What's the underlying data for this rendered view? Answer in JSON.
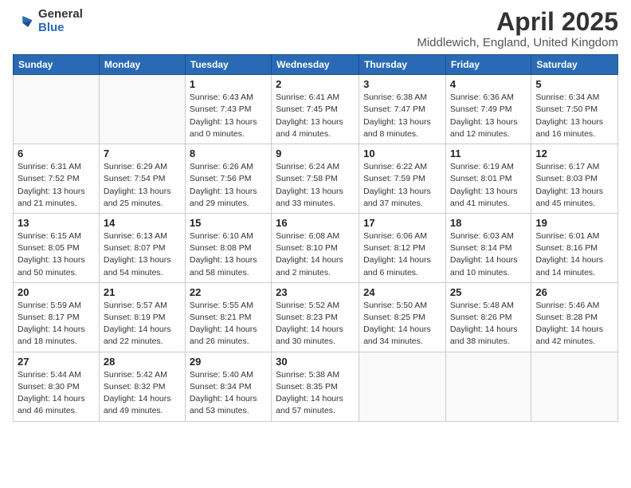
{
  "logo": {
    "general": "General",
    "blue": "Blue"
  },
  "title": "April 2025",
  "subtitle": "Middlewich, England, United Kingdom",
  "days_header": [
    "Sunday",
    "Monday",
    "Tuesday",
    "Wednesday",
    "Thursday",
    "Friday",
    "Saturday"
  ],
  "weeks": [
    [
      {
        "day": "",
        "info": ""
      },
      {
        "day": "",
        "info": ""
      },
      {
        "day": "1",
        "info": "Sunrise: 6:43 AM\nSunset: 7:43 PM\nDaylight: 13 hours and 0 minutes."
      },
      {
        "day": "2",
        "info": "Sunrise: 6:41 AM\nSunset: 7:45 PM\nDaylight: 13 hours and 4 minutes."
      },
      {
        "day": "3",
        "info": "Sunrise: 6:38 AM\nSunset: 7:47 PM\nDaylight: 13 hours and 8 minutes."
      },
      {
        "day": "4",
        "info": "Sunrise: 6:36 AM\nSunset: 7:49 PM\nDaylight: 13 hours and 12 minutes."
      },
      {
        "day": "5",
        "info": "Sunrise: 6:34 AM\nSunset: 7:50 PM\nDaylight: 13 hours and 16 minutes."
      }
    ],
    [
      {
        "day": "6",
        "info": "Sunrise: 6:31 AM\nSunset: 7:52 PM\nDaylight: 13 hours and 21 minutes."
      },
      {
        "day": "7",
        "info": "Sunrise: 6:29 AM\nSunset: 7:54 PM\nDaylight: 13 hours and 25 minutes."
      },
      {
        "day": "8",
        "info": "Sunrise: 6:26 AM\nSunset: 7:56 PM\nDaylight: 13 hours and 29 minutes."
      },
      {
        "day": "9",
        "info": "Sunrise: 6:24 AM\nSunset: 7:58 PM\nDaylight: 13 hours and 33 minutes."
      },
      {
        "day": "10",
        "info": "Sunrise: 6:22 AM\nSunset: 7:59 PM\nDaylight: 13 hours and 37 minutes."
      },
      {
        "day": "11",
        "info": "Sunrise: 6:19 AM\nSunset: 8:01 PM\nDaylight: 13 hours and 41 minutes."
      },
      {
        "day": "12",
        "info": "Sunrise: 6:17 AM\nSunset: 8:03 PM\nDaylight: 13 hours and 45 minutes."
      }
    ],
    [
      {
        "day": "13",
        "info": "Sunrise: 6:15 AM\nSunset: 8:05 PM\nDaylight: 13 hours and 50 minutes."
      },
      {
        "day": "14",
        "info": "Sunrise: 6:13 AM\nSunset: 8:07 PM\nDaylight: 13 hours and 54 minutes."
      },
      {
        "day": "15",
        "info": "Sunrise: 6:10 AM\nSunset: 8:08 PM\nDaylight: 13 hours and 58 minutes."
      },
      {
        "day": "16",
        "info": "Sunrise: 6:08 AM\nSunset: 8:10 PM\nDaylight: 14 hours and 2 minutes."
      },
      {
        "day": "17",
        "info": "Sunrise: 6:06 AM\nSunset: 8:12 PM\nDaylight: 14 hours and 6 minutes."
      },
      {
        "day": "18",
        "info": "Sunrise: 6:03 AM\nSunset: 8:14 PM\nDaylight: 14 hours and 10 minutes."
      },
      {
        "day": "19",
        "info": "Sunrise: 6:01 AM\nSunset: 8:16 PM\nDaylight: 14 hours and 14 minutes."
      }
    ],
    [
      {
        "day": "20",
        "info": "Sunrise: 5:59 AM\nSunset: 8:17 PM\nDaylight: 14 hours and 18 minutes."
      },
      {
        "day": "21",
        "info": "Sunrise: 5:57 AM\nSunset: 8:19 PM\nDaylight: 14 hours and 22 minutes."
      },
      {
        "day": "22",
        "info": "Sunrise: 5:55 AM\nSunset: 8:21 PM\nDaylight: 14 hours and 26 minutes."
      },
      {
        "day": "23",
        "info": "Sunrise: 5:52 AM\nSunset: 8:23 PM\nDaylight: 14 hours and 30 minutes."
      },
      {
        "day": "24",
        "info": "Sunrise: 5:50 AM\nSunset: 8:25 PM\nDaylight: 14 hours and 34 minutes."
      },
      {
        "day": "25",
        "info": "Sunrise: 5:48 AM\nSunset: 8:26 PM\nDaylight: 14 hours and 38 minutes."
      },
      {
        "day": "26",
        "info": "Sunrise: 5:46 AM\nSunset: 8:28 PM\nDaylight: 14 hours and 42 minutes."
      }
    ],
    [
      {
        "day": "27",
        "info": "Sunrise: 5:44 AM\nSunset: 8:30 PM\nDaylight: 14 hours and 46 minutes."
      },
      {
        "day": "28",
        "info": "Sunrise: 5:42 AM\nSunset: 8:32 PM\nDaylight: 14 hours and 49 minutes."
      },
      {
        "day": "29",
        "info": "Sunrise: 5:40 AM\nSunset: 8:34 PM\nDaylight: 14 hours and 53 minutes."
      },
      {
        "day": "30",
        "info": "Sunrise: 5:38 AM\nSunset: 8:35 PM\nDaylight: 14 hours and 57 minutes."
      },
      {
        "day": "",
        "info": ""
      },
      {
        "day": "",
        "info": ""
      },
      {
        "day": "",
        "info": ""
      }
    ]
  ]
}
